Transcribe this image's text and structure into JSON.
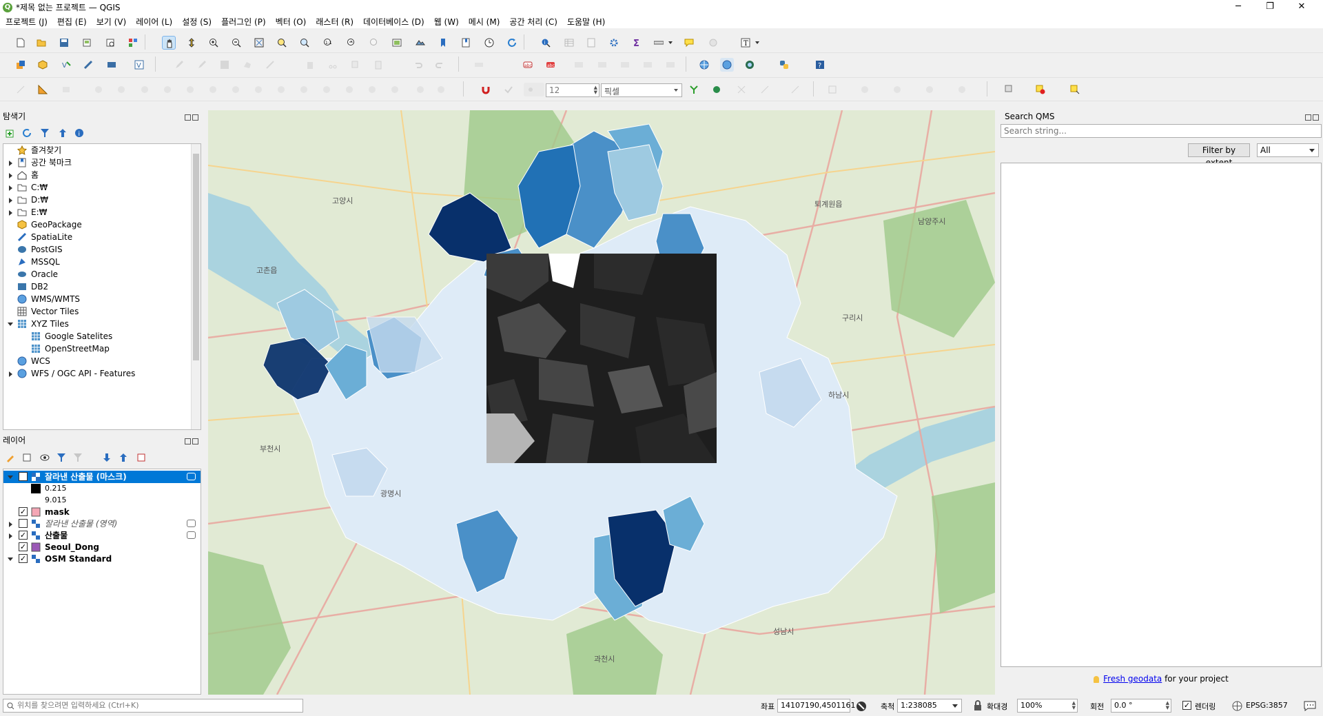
{
  "window": {
    "title": "*제목 없는 프로젝트 — QGIS",
    "minimize": "─",
    "maximize": "❐",
    "close": "✕"
  },
  "menu": [
    "프로젝트 (J)",
    "편집 (E)",
    "보기 (V)",
    "레이어 (L)",
    "설정 (S)",
    "플러그인 (P)",
    "벡터 (O)",
    "래스터 (R)",
    "데이터베이스 (D)",
    "웹 (W)",
    "메시 (M)",
    "공간 처리 (C)",
    "도움말 (H)"
  ],
  "digitize": {
    "snap_tolerance": "12",
    "unit": "픽셀"
  },
  "browser": {
    "title": "탐색기",
    "items": [
      {
        "label": "즐겨찾기",
        "icon": "star-icon"
      },
      {
        "label": "공간 북마크",
        "icon": "bookmark-icon"
      },
      {
        "label": "홈",
        "icon": "home-icon"
      },
      {
        "label": "C:₩",
        "icon": "folder-icon"
      },
      {
        "label": "D:₩",
        "icon": "folder-icon"
      },
      {
        "label": "E:₩",
        "icon": "folder-icon"
      },
      {
        "label": "GeoPackage",
        "icon": "geopackage-icon"
      },
      {
        "label": "SpatiaLite",
        "icon": "spatialite-icon"
      },
      {
        "label": "PostGIS",
        "icon": "postgis-icon"
      },
      {
        "label": "MSSQL",
        "icon": "mssql-icon"
      },
      {
        "label": "Oracle",
        "icon": "oracle-icon"
      },
      {
        "label": "DB2",
        "icon": "db2-icon"
      },
      {
        "label": "WMS/WMTS",
        "icon": "wms-icon"
      },
      {
        "label": "Vector Tiles",
        "icon": "vector-tiles-icon"
      },
      {
        "label": "XYZ Tiles",
        "icon": "xyz-tiles-icon"
      },
      {
        "label": "Google Satelites",
        "icon": "xyz-tiles-icon"
      },
      {
        "label": "OpenStreetMap",
        "icon": "xyz-tiles-icon"
      },
      {
        "label": "WCS",
        "icon": "wcs-icon"
      },
      {
        "label": "WFS / OGC API - Features",
        "icon": "wfs-icon"
      }
    ]
  },
  "layers": {
    "title": "레이어",
    "items": [
      {
        "label": "잘라낸 산출물 (마스크)",
        "bold": true,
        "checked": true,
        "selected": true
      },
      {
        "label": "0.215",
        "legend": true
      },
      {
        "label": "9.015",
        "legend": true
      },
      {
        "label": "mask",
        "bold": true,
        "checked": true
      },
      {
        "label": "잘라낸 산출물 (영역)",
        "italic": true,
        "checked": false
      },
      {
        "label": "산출물",
        "bold": true,
        "checked": true
      },
      {
        "label": "Seoul_Dong",
        "bold": true,
        "checked": true
      },
      {
        "label": "OSM Standard",
        "bold": true,
        "checked": true
      }
    ]
  },
  "qms": {
    "title": "Search QMS",
    "placeholder": "Search string...",
    "filter_button": "Filter by extent",
    "filter_value": "All",
    "footer_link": "Fresh geodata",
    "footer_text": " for your project"
  },
  "map_labels": [
    "고양시",
    "구리시",
    "하남시",
    "부천시",
    "광명시",
    "과천시",
    "남양주시",
    "퇴계원읍",
    "고촌읍",
    "성남시"
  ],
  "status": {
    "search_placeholder": "위치를 찾으려면 입력하세요 (Ctrl+K)",
    "coord_label": "좌표",
    "coord": "14107190,4501161",
    "scale_label": "축척",
    "scale": "1:238085",
    "mag_label": "확대경",
    "mag": "100%",
    "rot_label": "회전",
    "rot": "0.0 °",
    "render_label": "렌더링",
    "crs": "EPSG:3857"
  },
  "colors": {
    "blue_dark": "#08306b",
    "blue_mid": "#2171b5",
    "blue_light": "#9ecae1",
    "blue_pale": "#deebf7",
    "accent": "#0078d7"
  }
}
